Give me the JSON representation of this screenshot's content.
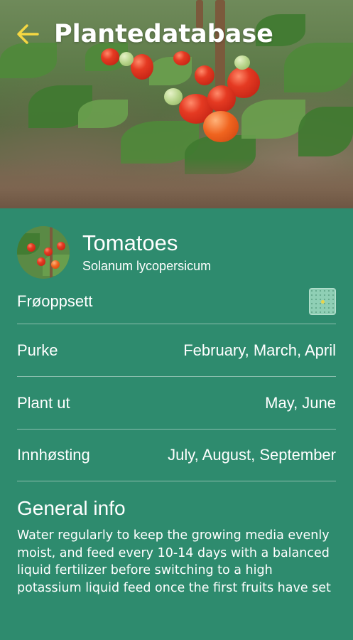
{
  "colors": {
    "background": "#2e8b6e",
    "back_arrow": "#f5d742",
    "text": "#ffffff"
  },
  "appbar": {
    "title": "Plantedatabase",
    "back_icon": "arrow-left-icon"
  },
  "hero": {
    "image": "tomato-plants-photo"
  },
  "plant": {
    "name": "Tomatoes",
    "latin_name": "Solanum lycopersicum",
    "avatar": "tomato-thumbnail"
  },
  "details": {
    "seed_setup": {
      "label": "Frøoppsett",
      "icon": "seed-grid-icon"
    },
    "rows": [
      {
        "label": "Purke",
        "value": "February, March, April"
      },
      {
        "label": "Plant ut",
        "value": "May, June"
      },
      {
        "label": "Innhøsting",
        "value": "July, August, September"
      }
    ]
  },
  "general_info": {
    "title": "General info",
    "text": "Water regularly to keep the growing media evenly moist, and feed every 10-14 days with a balanced liquid fertilizer before switching to a high potassium liquid feed once the first fruits have set"
  }
}
